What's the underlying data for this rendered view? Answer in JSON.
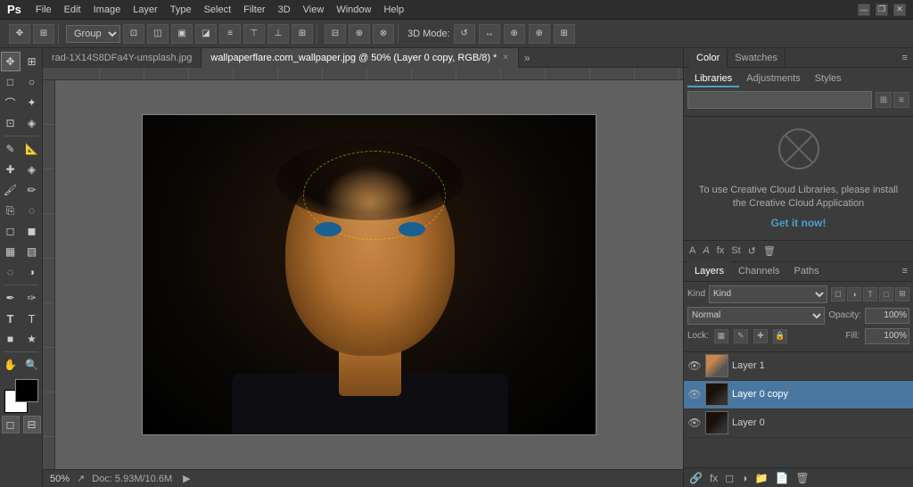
{
  "titlebar": {
    "logo": "Ps",
    "menus": [
      "File",
      "Edit",
      "Image",
      "Layer",
      "Type",
      "Select",
      "Filter",
      "3D",
      "View",
      "Window",
      "Help"
    ],
    "window_controls": [
      "—",
      "❐",
      "✕"
    ]
  },
  "toolbar": {
    "group_label": "Group",
    "mode_label": "3D Mode:"
  },
  "tabs": [
    {
      "label": "rad-1X14S8DFa4Y-unsplash.jpg",
      "active": false,
      "modified": false
    },
    {
      "label": "wallpaperflare.com_wallpaper.jpg @ 50% (Layer 0 copy, RGB/8) *",
      "active": true,
      "modified": true
    }
  ],
  "status": {
    "zoom": "50%",
    "doc_info": "Doc: 5.93M/10.6M"
  },
  "color_panel": {
    "tabs": [
      "Color",
      "Swatches"
    ],
    "active_tab": "Color"
  },
  "libraries": {
    "tabs": [
      "Libraries",
      "Adjustments",
      "Styles"
    ],
    "active_tab": "Libraries",
    "subtabs": [
      "Libraries",
      "Adjustments",
      "Styles"
    ]
  },
  "cc_promo": {
    "icon": "⊗",
    "text": "To use Creative Cloud Libraries, please install the Creative Cloud Application",
    "link": "Get it now!"
  },
  "layers_panel": {
    "tabs": [
      "Layers",
      "Channels",
      "Paths"
    ],
    "active_tab": "Layers",
    "kind_label": "Kind",
    "kind_placeholder": "Kind",
    "blend_mode": "Normal",
    "opacity_label": "Opacity:",
    "opacity_value": "100%",
    "lock_label": "Lock:",
    "fill_label": "Fill:",
    "fill_value": "100%",
    "layers": [
      {
        "name": "Layer 1",
        "visible": true,
        "active": false,
        "thumb_color": "#8a7a6a"
      },
      {
        "name": "Layer 0 copy",
        "visible": true,
        "active": true,
        "thumb_color": "#2a2a2a"
      },
      {
        "name": "Layer 0",
        "visible": true,
        "active": false,
        "thumb_color": "#2a2a2a"
      }
    ]
  },
  "icons": {
    "eye": "👁",
    "move": "✥",
    "select_rect": "□",
    "select_ellipse": "○",
    "lasso": "⌒",
    "magic_wand": "✦",
    "crop": "⊡",
    "eyedropper": "✎",
    "heal": "✚",
    "brush": "🖌",
    "clone": "⎘",
    "eraser": "◻",
    "gradient": "▦",
    "blur": "◌",
    "dodge": "◑",
    "pen": "✒",
    "text": "T",
    "shape": "■",
    "hand": "✋",
    "zoom": "🔍",
    "link": "🔗",
    "mask": "◻",
    "fx": "fx",
    "new_layer": "📄",
    "trash": "🗑"
  }
}
